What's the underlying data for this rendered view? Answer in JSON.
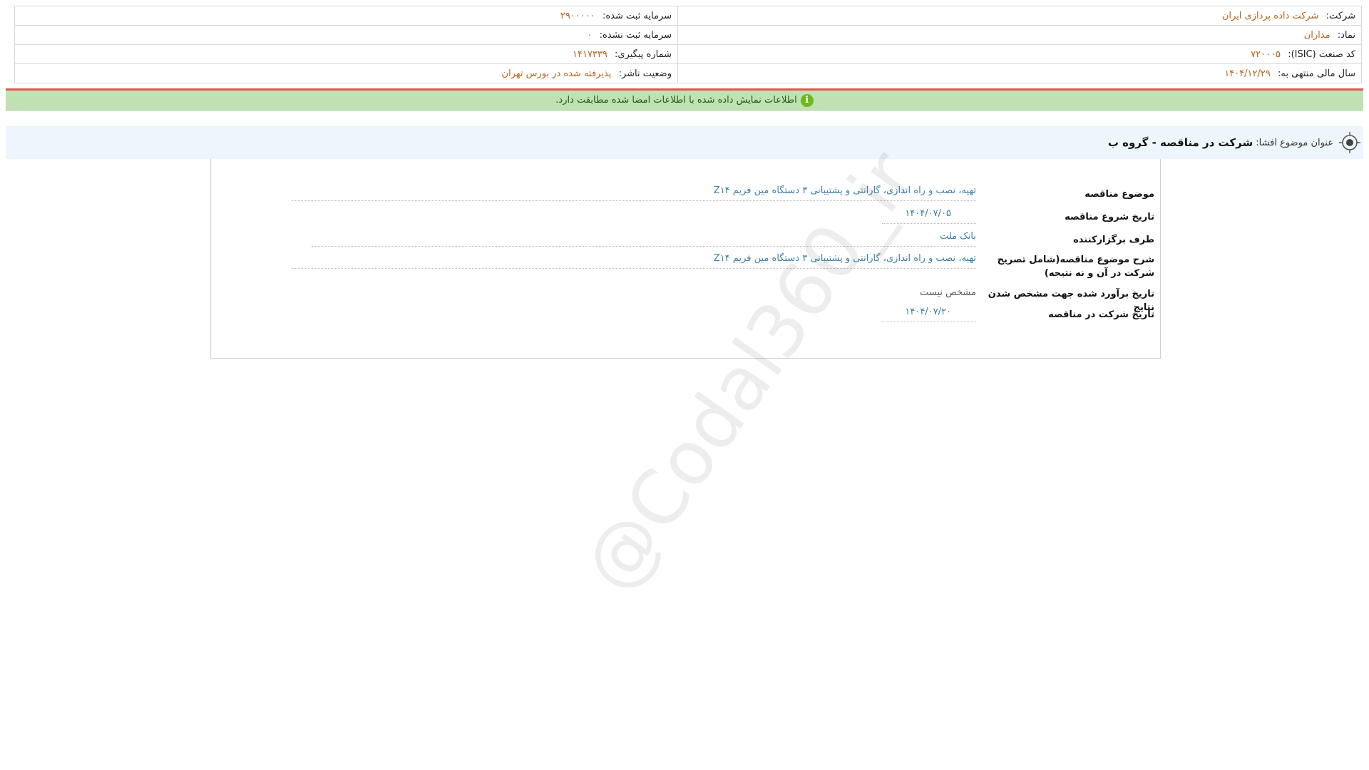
{
  "header": {
    "company_label": "شرکت:",
    "company_value": "شرکت داده پردازی ایران",
    "symbol_label": "نماد:",
    "symbol_value": "مداران",
    "isic_label": "کد صنعت (ISIC):",
    "isic_value": "۷۲۰۰۰۵",
    "fiscal_year_label": "سال مالی منتهی به:",
    "fiscal_year_value": "۱۴۰۴/۱۲/۲۹",
    "registered_capital_label": "سرمایه ثبت شده:",
    "registered_capital_value": "۲۹۰۰۰۰۰",
    "unregistered_capital_label": "سرمایه ثبت نشده:",
    "unregistered_capital_value": "۰",
    "tracking_label": "شماره پیگیری:",
    "tracking_value": "۱۴۱۷۳۳۹",
    "publisher_status_label": "وضعیت ناشر:",
    "publisher_status_value": "پذیرفته شده در بورس تهران"
  },
  "status_bar": {
    "icon": "info-icon",
    "icon_glyph": "i",
    "text": "اطلاعات نمایش داده شده با اطلاعات امضا شده مطابقت دارد."
  },
  "title": {
    "label": "عنوان موضوع افشا:",
    "value": "شرکت در مناقصه - گروه ب"
  },
  "details": {
    "subject_label": "موضوع مناقصه",
    "subject_value": "تهیه، نصب و راه اندازی، گارانتی و پشتیبانی ۳ دستگاه مین فریم Z۱۴",
    "start_date_label": "تاریخ شروع مناقصه",
    "start_date_value": "۱۴۰۴/۰۷/۰۵",
    "organizer_label": "طرف برگزارکننده",
    "organizer_value": "بانک ملت",
    "description_label": "شرح موضوع مناقصه(شامل تصریح شرکت در آن و نه نتیجه)",
    "description_value": "تهیه، نصب و راه اندازی، گارانتی و پشتیبانی ۳ دستگاه مین فریم Z۱۴",
    "estimated_result_date_label": "تاریخ برآورد شده جهت مشخص شدن نتایج",
    "estimated_result_date_value": "مشخص نیست",
    "participation_date_label": "تاریخ شرکت در مناقصه",
    "participation_date_value": "۱۴۰۴/۰۷/۲۰"
  },
  "watermark": "@Codal360_ir",
  "colors": {
    "value_orange": "#b5651d",
    "value_blue": "#3f7fa6",
    "status_green": "#bfe1b3",
    "status_border_red": "#e0554f",
    "title_bg": "#eef5fc"
  }
}
